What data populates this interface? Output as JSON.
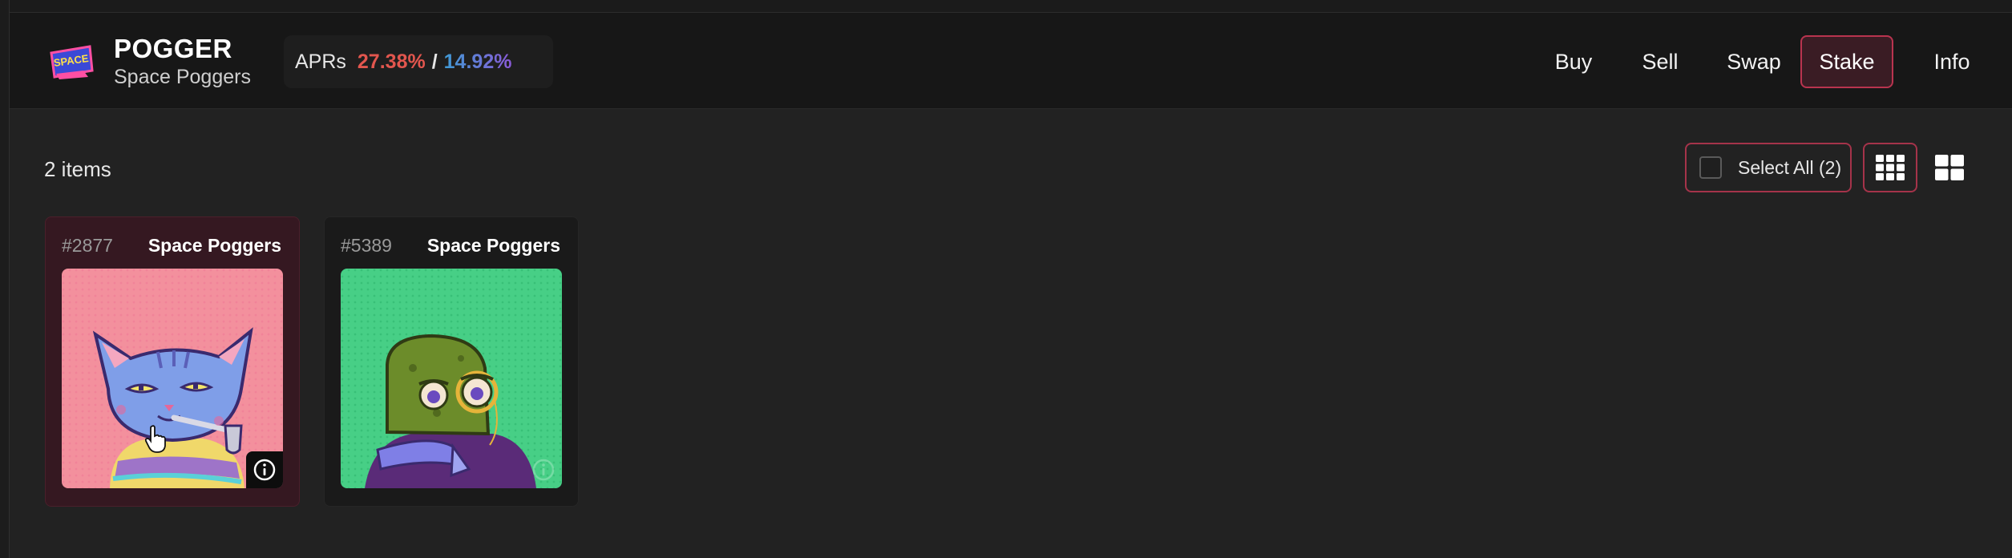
{
  "header": {
    "title": "POGGER",
    "subtitle": "Space Poggers",
    "logo_text": "SPACE",
    "apr": {
      "label": "APRs",
      "value_a": "27.38%",
      "separator": "/",
      "value_b": "14.92%"
    }
  },
  "nav": {
    "items": [
      {
        "label": "Buy",
        "active": false
      },
      {
        "label": "Sell",
        "active": false
      },
      {
        "label": "Swap",
        "active": false
      },
      {
        "label": "Stake",
        "active": true
      },
      {
        "label": "Info",
        "active": false
      }
    ]
  },
  "toolbar": {
    "count_text": "2 items",
    "select_all_label": "Select All (2)",
    "view_modes": [
      "small-grid",
      "large-grid"
    ],
    "active_view": "small-grid"
  },
  "cards": [
    {
      "id": "#2877",
      "collection": "Space Poggers",
      "selected": true,
      "image": "blue-cat-with-pipe"
    },
    {
      "id": "#5389",
      "collection": "Space Poggers",
      "selected": false,
      "image": "green-frog-with-monocle"
    }
  ],
  "colors": {
    "background": "#222222",
    "header": "#171717",
    "accent": "#b9344f",
    "apr_a": "#e2564e",
    "apr_b_start": "#3f9bd6",
    "apr_b_end": "#8a5ad8",
    "selected_card": "#351821"
  }
}
